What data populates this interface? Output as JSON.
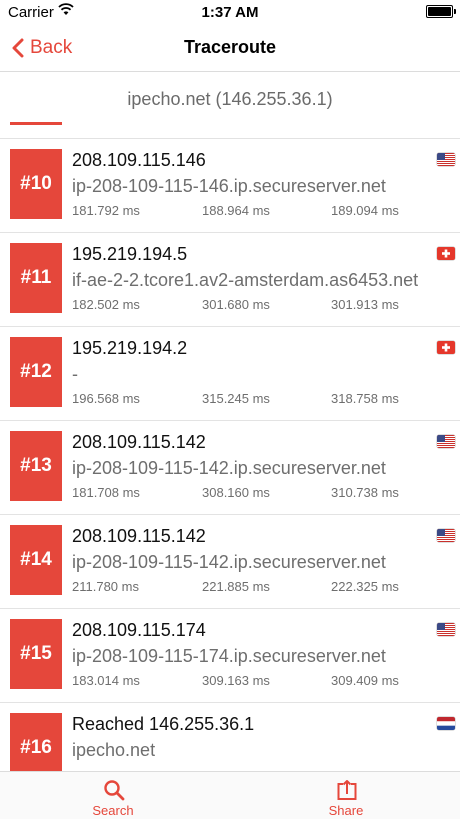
{
  "status_bar": {
    "carrier": "Carrier",
    "time": "1:37 AM"
  },
  "nav": {
    "back_label": "Back",
    "title": "Traceroute"
  },
  "target": {
    "label": "ipecho.net (146.255.36.1)"
  },
  "hops": [
    {
      "number": "#10",
      "ip": "208.109.115.146",
      "host": "ip-208-109-115-146.ip.secureserver.net",
      "times": [
        "181.792 ms",
        "188.964 ms",
        "189.094 ms"
      ],
      "flag": "us-flag-icon"
    },
    {
      "number": "#11",
      "ip": "195.219.194.5",
      "host": "if-ae-2-2.tcore1.av2-amsterdam.as6453.net",
      "times": [
        "182.502 ms",
        "301.680 ms",
        "301.913 ms"
      ],
      "flag": "ch-flag-icon"
    },
    {
      "number": "#12",
      "ip": "195.219.194.2",
      "host": "-",
      "times": [
        "196.568 ms",
        "315.245 ms",
        "318.758 ms"
      ],
      "flag": "ch-flag-icon"
    },
    {
      "number": "#13",
      "ip": "208.109.115.142",
      "host": "ip-208-109-115-142.ip.secureserver.net",
      "times": [
        "181.708 ms",
        "308.160 ms",
        "310.738 ms"
      ],
      "flag": "us-flag-icon"
    },
    {
      "number": "#14",
      "ip": "208.109.115.142",
      "host": "ip-208-109-115-142.ip.secureserver.net",
      "times": [
        "211.780 ms",
        "221.885 ms",
        "222.325 ms"
      ],
      "flag": "us-flag-icon"
    },
    {
      "number": "#15",
      "ip": "208.109.115.174",
      "host": "ip-208-109-115-174.ip.secureserver.net",
      "times": [
        "183.014 ms",
        "309.163 ms",
        "309.409 ms"
      ],
      "flag": "us-flag-icon"
    },
    {
      "number": "#16",
      "ip": "Reached 146.255.36.1",
      "host": "ipecho.net",
      "times": [],
      "flag": "nl-flag-icon"
    }
  ],
  "tab_bar": {
    "search_label": "Search",
    "share_label": "Share"
  },
  "colors": {
    "accent": "#e5473b",
    "secondary_text": "#6e6e6e",
    "divider": "#e3e3e3"
  }
}
